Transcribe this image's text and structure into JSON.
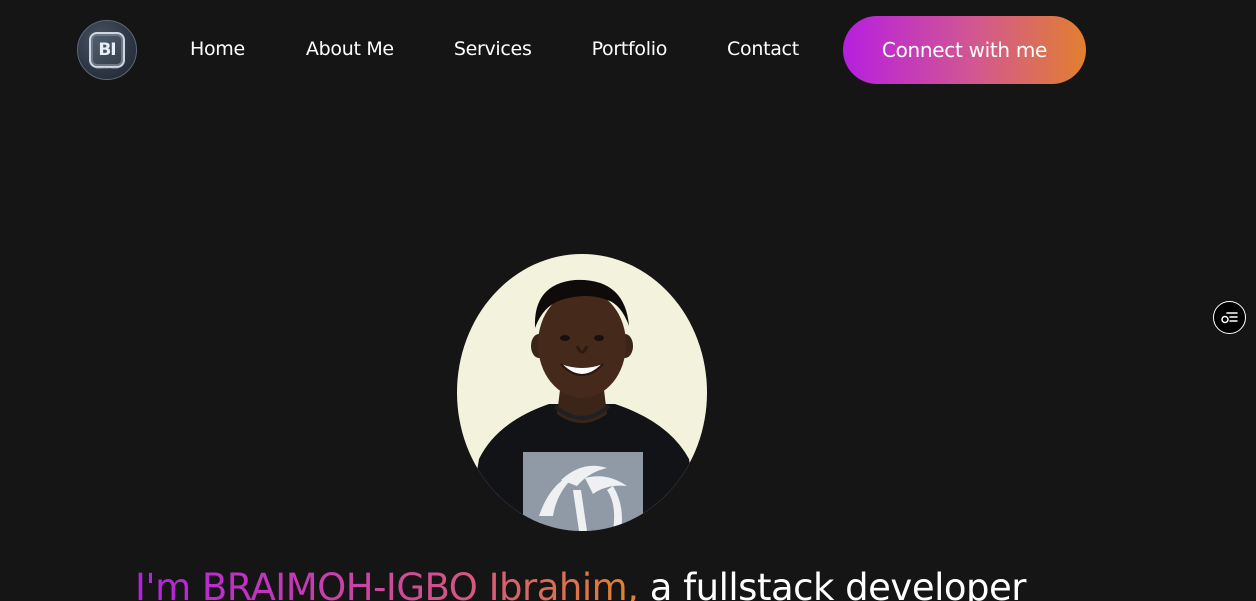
{
  "logo": {
    "text": "BI",
    "tagline": "BRAIMOH-IGBO"
  },
  "nav": {
    "items": [
      {
        "label": "Home"
      },
      {
        "label": "About Me"
      },
      {
        "label": "Services"
      },
      {
        "label": "Portfolio"
      },
      {
        "label": "Contact"
      }
    ],
    "cta_label": "Connect with me"
  },
  "side_widget": {
    "icon": "filter-list-icon"
  },
  "hero": {
    "avatar_alt": "profile-photo",
    "headline_prefix": "I'm BRAIMOH-IGBO Ibrahim,",
    "headline_suffix": " a fullstack developer"
  },
  "colors": {
    "background": "#161515",
    "gradient_start": "#b61fe0",
    "gradient_end": "#e27f2f",
    "avatar_bg": "#f3f3dd"
  }
}
